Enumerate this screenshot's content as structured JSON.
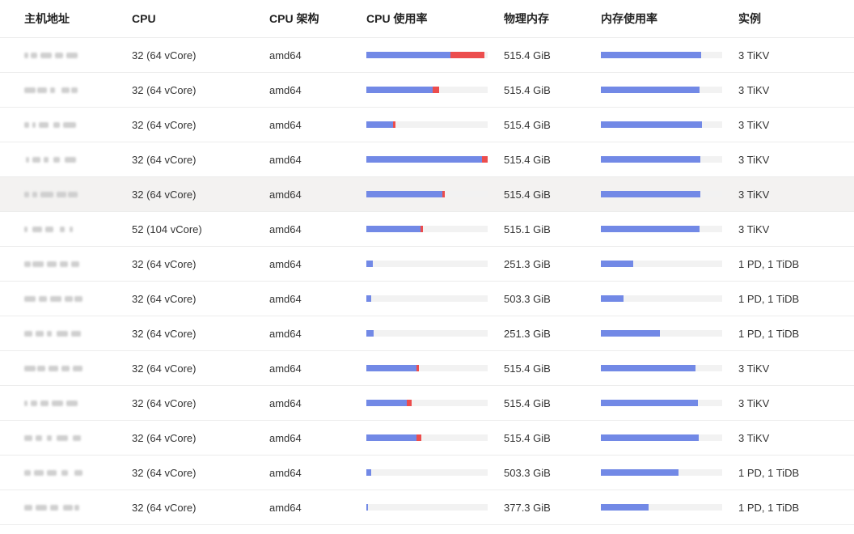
{
  "colors": {
    "bar_blue": "#7289e6",
    "bar_red": "#ec4d4d",
    "bar_track": "#f2f2f2",
    "row_hover": "#f3f2f1"
  },
  "columns": {
    "host": "主机地址",
    "cpu": "CPU",
    "arch": "CPU 架构",
    "cpu_usage": "CPU 使用率",
    "memory": "物理内存",
    "memory_usage": "内存使用率",
    "instances": "实例"
  },
  "rows": [
    {
      "cpu": "32 (64 vCore)",
      "arch": "amd64",
      "cpu_usage": {
        "blue": 0.693,
        "red": 0.28
      },
      "memory": "515.4 GiB",
      "memory_usage": 0.827,
      "instances": "3 TiKV"
    },
    {
      "cpu": "32 (64 vCore)",
      "arch": "amd64",
      "cpu_usage": {
        "blue": 0.547,
        "red": 0.053
      },
      "memory": "515.4 GiB",
      "memory_usage": 0.813,
      "instances": "3 TiKV"
    },
    {
      "cpu": "32 (64 vCore)",
      "arch": "amd64",
      "cpu_usage": {
        "blue": 0.22,
        "red": 0.02
      },
      "memory": "515.4 GiB",
      "memory_usage": 0.833,
      "instances": "3 TiKV"
    },
    {
      "cpu": "32 (64 vCore)",
      "arch": "amd64",
      "cpu_usage": {
        "blue": 0.953,
        "red": 0.047
      },
      "memory": "515.4 GiB",
      "memory_usage": 0.82,
      "instances": "3 TiKV"
    },
    {
      "cpu": "32 (64 vCore)",
      "arch": "amd64",
      "cpu_usage": {
        "blue": 0.627,
        "red": 0.02
      },
      "memory": "515.4 GiB",
      "memory_usage": 0.82,
      "instances": "3 TiKV",
      "hover": true
    },
    {
      "cpu": "52 (104 vCore)",
      "arch": "amd64",
      "cpu_usage": {
        "blue": 0.447,
        "red": 0.02
      },
      "memory": "515.1 GiB",
      "memory_usage": 0.813,
      "instances": "3 TiKV"
    },
    {
      "cpu": "32 (64 vCore)",
      "arch": "amd64",
      "cpu_usage": {
        "blue": 0.053,
        "red": 0
      },
      "memory": "251.3 GiB",
      "memory_usage": 0.267,
      "instances": "1 PD, 1 TiDB"
    },
    {
      "cpu": "32 (64 vCore)",
      "arch": "amd64",
      "cpu_usage": {
        "blue": 0.04,
        "red": 0
      },
      "memory": "503.3 GiB",
      "memory_usage": 0.187,
      "instances": "1 PD, 1 TiDB"
    },
    {
      "cpu": "32 (64 vCore)",
      "arch": "amd64",
      "cpu_usage": {
        "blue": 0.06,
        "red": 0
      },
      "memory": "251.3 GiB",
      "memory_usage": 0.487,
      "instances": "1 PD, 1 TiDB"
    },
    {
      "cpu": "32 (64 vCore)",
      "arch": "amd64",
      "cpu_usage": {
        "blue": 0.413,
        "red": 0.02
      },
      "memory": "515.4 GiB",
      "memory_usage": 0.78,
      "instances": "3 TiKV"
    },
    {
      "cpu": "32 (64 vCore)",
      "arch": "amd64",
      "cpu_usage": {
        "blue": 0.333,
        "red": 0.04
      },
      "memory": "515.4 GiB",
      "memory_usage": 0.8,
      "instances": "3 TiKV"
    },
    {
      "cpu": "32 (64 vCore)",
      "arch": "amd64",
      "cpu_usage": {
        "blue": 0.413,
        "red": 0.04
      },
      "memory": "515.4 GiB",
      "memory_usage": 0.807,
      "instances": "3 TiKV"
    },
    {
      "cpu": "32 (64 vCore)",
      "arch": "amd64",
      "cpu_usage": {
        "blue": 0.04,
        "red": 0
      },
      "memory": "503.3 GiB",
      "memory_usage": 0.64,
      "instances": "1 PD, 1 TiDB"
    },
    {
      "cpu": "32 (64 vCore)",
      "arch": "amd64",
      "cpu_usage": {
        "blue": 0.013,
        "red": 0
      },
      "memory": "377.3 GiB",
      "memory_usage": 0.393,
      "instances": "1 PD, 1 TiDB"
    }
  ]
}
